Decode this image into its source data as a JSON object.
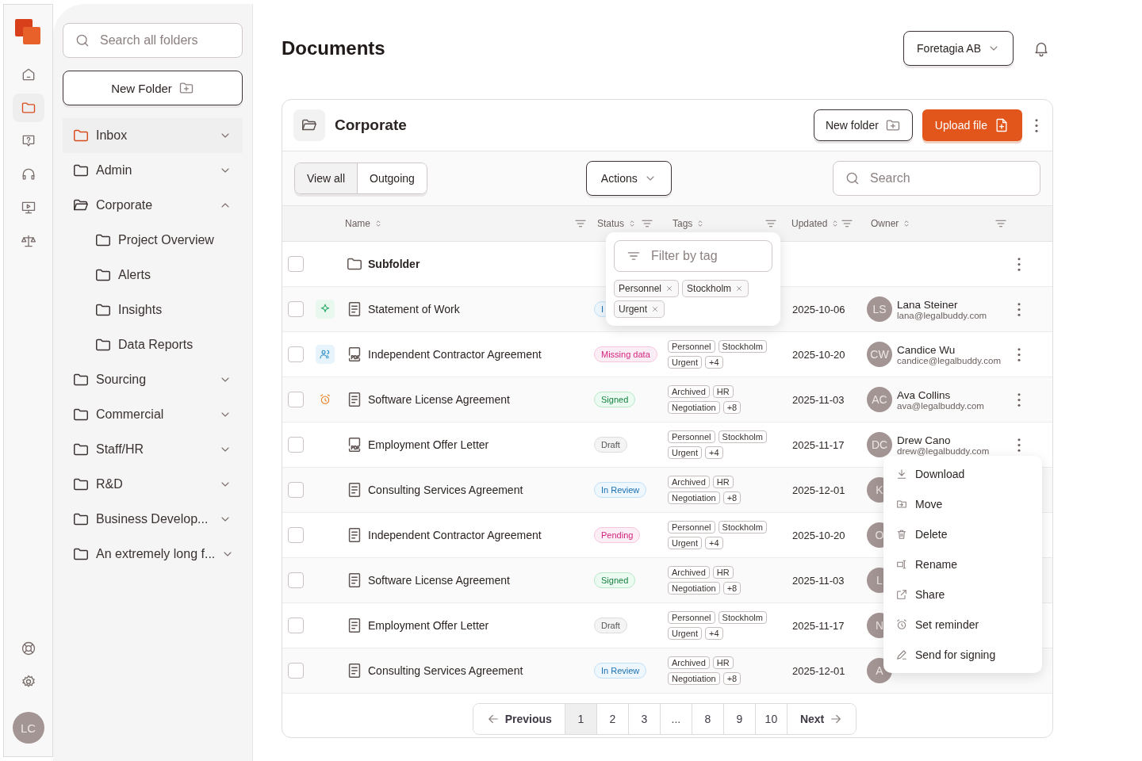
{
  "rail": {
    "items": [
      {
        "selected": false
      },
      {
        "selected": true
      },
      {
        "selected": false
      },
      {
        "selected": false
      },
      {
        "selected": false
      },
      {
        "selected": false
      }
    ],
    "user": {
      "initials": "LC"
    }
  },
  "folders": {
    "search": {
      "placeholder": "Search all folders"
    },
    "new_button": "New Folder",
    "items": [
      {
        "label": "Inbox",
        "selected": true,
        "expanded": false
      },
      {
        "label": "Admin",
        "selected": false,
        "expanded": false
      },
      {
        "label": "Corporate",
        "selected": false,
        "expanded": true,
        "children": [
          {
            "label": "Project Overview",
            "selected": false
          },
          {
            "label": "Alerts",
            "selected": false
          },
          {
            "label": "Insights",
            "selected": false
          },
          {
            "label": "Data Reports",
            "selected": false
          }
        ]
      },
      {
        "label": "Sourcing",
        "selected": false,
        "expanded": false
      },
      {
        "label": "Commercial",
        "selected": false,
        "expanded": false
      },
      {
        "label": "Staff/HR",
        "selected": false,
        "expanded": false
      },
      {
        "label": "R&D",
        "selected": false,
        "expanded": false
      },
      {
        "label": "Business Develop...",
        "selected": false,
        "expanded": false
      },
      {
        "label": "An extremely long f...",
        "selected": false,
        "expanded": false
      }
    ]
  },
  "page": {
    "title": "Documents",
    "org": "Foretagia AB"
  },
  "card": {
    "title": "Corporate",
    "new_folder": "New folder",
    "upload": "Upload file",
    "views": [
      {
        "label": "View all",
        "selected": true
      },
      {
        "label": "Outgoing",
        "selected": false
      }
    ],
    "actions": "Actions",
    "search": {
      "placeholder": "Search"
    }
  },
  "table": {
    "columns": [
      "Name",
      "Status",
      "Tags",
      "Updated",
      "Owner"
    ],
    "rows": [
      {
        "kind": "folder",
        "name": "Subfolder",
        "checked": false
      },
      {
        "kind": "doc",
        "marker": {
          "kind": "ai"
        },
        "name": "Statement of Work",
        "checked": false,
        "status": {
          "label": "I",
          "kind": "review"
        },
        "updated": "2025-10-06",
        "owner": {
          "initials": "LS",
          "name": "Lana Steiner",
          "email": "lana@legalbuddy.com"
        }
      },
      {
        "kind": "pdf",
        "marker": {
          "kind": "shared"
        },
        "name": "Independent Contractor Agreement",
        "checked": false,
        "status": {
          "label": "Missing data",
          "kind": "missing"
        },
        "tags": [
          "Personnel",
          "Stockholm",
          "Urgent",
          "+4"
        ],
        "updated": "2025-10-20",
        "owner": {
          "initials": "CW",
          "name": "Candice Wu",
          "email": "candice@legalbuddy.com"
        }
      },
      {
        "kind": "doc",
        "marker": {
          "kind": "reminder"
        },
        "name": "Software License Agreement",
        "checked": false,
        "status": {
          "label": "Signed",
          "kind": "signed"
        },
        "tags": [
          "Archived",
          "HR",
          "Negotiation",
          "+8"
        ],
        "updated": "2025-11-03",
        "owner": {
          "initials": "AC",
          "name": "Ava Collins",
          "email": "ava@legalbuddy.com"
        }
      },
      {
        "kind": "pdf",
        "name": "Employment Offer Letter",
        "checked": false,
        "status": {
          "label": "Draft",
          "kind": "draft"
        },
        "tags": [
          "Personnel",
          "Stockholm",
          "Urgent",
          "+4"
        ],
        "updated": "2025-11-17",
        "owner": {
          "initials": "DC",
          "name": "Drew Cano",
          "email": "drew@legalbuddy.com"
        }
      },
      {
        "kind": "doc",
        "name": "Consulting Services Agreement",
        "checked": false,
        "status": {
          "label": "In Review",
          "kind": "review"
        },
        "tags": [
          "Archived",
          "HR",
          "Negotiation",
          "+8"
        ],
        "updated": "2025-12-01",
        "owner": {
          "initials": "K"
        }
      },
      {
        "kind": "doc",
        "name": "Independent Contractor Agreement",
        "checked": false,
        "status": {
          "label": "Pending",
          "kind": "pending"
        },
        "tags": [
          "Personnel",
          "Stockholm",
          "Urgent",
          "+4"
        ],
        "updated": "2025-10-20",
        "owner": {
          "initials": "O"
        }
      },
      {
        "kind": "doc",
        "name": "Software License Agreement",
        "checked": false,
        "status": {
          "label": "Signed",
          "kind": "signed"
        },
        "tags": [
          "Archived",
          "HR",
          "Negotiation",
          "+8"
        ],
        "updated": "2025-11-03",
        "owner": {
          "initials": "L"
        }
      },
      {
        "kind": "doc",
        "name": "Employment Offer Letter",
        "checked": false,
        "status": {
          "label": "Draft",
          "kind": "draft"
        },
        "tags": [
          "Personnel",
          "Stockholm",
          "Urgent",
          "+4"
        ],
        "updated": "2025-11-17",
        "owner": {
          "initials": "N"
        }
      },
      {
        "kind": "doc",
        "name": "Consulting Services Agreement",
        "checked": false,
        "status": {
          "label": "In Review",
          "kind": "review"
        },
        "tags": [
          "Archived",
          "HR",
          "Negotiation",
          "+8"
        ],
        "updated": "2025-12-01",
        "owner": {
          "initials": "A"
        }
      }
    ]
  },
  "tag_filter": {
    "placeholder": "Filter by tag",
    "chips": [
      "Personnel",
      "Stockholm",
      "Urgent"
    ]
  },
  "row_menu": {
    "items": [
      "Download",
      "Move",
      "Delete",
      "Rename",
      "Share",
      "Set reminder",
      "Send for signing"
    ]
  },
  "pagination": {
    "previous": "Previous",
    "next": "Next",
    "pages": [
      {
        "label": "1",
        "selected": true
      },
      {
        "label": "2",
        "selected": false
      },
      {
        "label": "3",
        "selected": false
      },
      {
        "label": "...",
        "selected": false
      },
      {
        "label": "8",
        "selected": false
      },
      {
        "label": "9",
        "selected": false
      },
      {
        "label": "10",
        "selected": false
      }
    ]
  }
}
